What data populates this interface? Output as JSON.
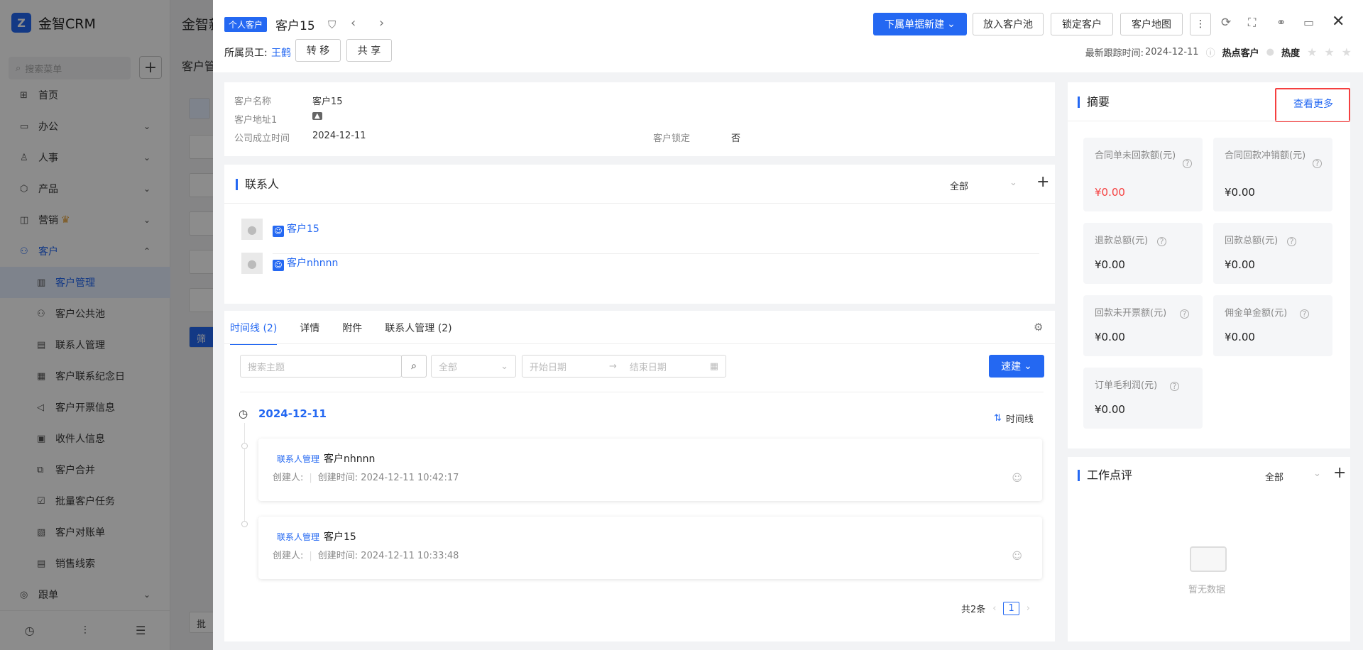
{
  "app": {
    "name": "金智CRM"
  },
  "sidebar": {
    "search_placeholder": "搜索菜单",
    "items": [
      {
        "label": "首页",
        "icon": "home-icon"
      },
      {
        "label": "办公",
        "icon": "office-icon"
      },
      {
        "label": "人事",
        "icon": "people-icon"
      },
      {
        "label": "产品",
        "icon": "product-icon"
      },
      {
        "label": "营销",
        "icon": "marketing-icon"
      },
      {
        "label": "客户",
        "icon": "customer-icon"
      },
      {
        "label": "跟单",
        "icon": "follow-icon"
      }
    ],
    "sub_items": [
      "客户管理",
      "客户公共池",
      "联系人管理",
      "客户联系纪念日",
      "客户开票信息",
      "收件人信息",
      "客户合并",
      "批量客户任务",
      "客户对账单",
      "销售线索"
    ]
  },
  "background": {
    "title": "金智新",
    "crumb": "客户管",
    "filter_btn": "筛",
    "bottom_btn": "批"
  },
  "drawer": {
    "tag": "个人客户",
    "title": "客户15",
    "employee_label": "所属员工:",
    "employee_name": "王鹤",
    "transfer_btn": "转 移",
    "share_btn": "共 享",
    "actions": {
      "new_btn": "下属单据新建",
      "pool_btn": "放入客户池",
      "lock_btn": "锁定客户",
      "map_btn": "客户地图"
    },
    "last_follow_label": "最新跟踪时间:",
    "last_follow_value": "2024-12-11",
    "hot_label": "热点客户",
    "heat_label": "热度",
    "heat_rating": 0,
    "info": {
      "name_label": "客户名称",
      "name_value": "客户15",
      "address_label": "客户地址1",
      "founded_label": "公司成立时间",
      "founded_value": "2024-12-11",
      "lock_label": "客户锁定",
      "lock_value": "否"
    },
    "contacts": {
      "title": "联系人",
      "filter": "全部",
      "items": [
        "客户15",
        "客户nhnnn"
      ]
    },
    "timeline": {
      "tabs": [
        "时间线 (2)",
        "详情",
        "附件",
        "联系人管理 (2)"
      ],
      "search_placeholder": "搜索主题",
      "type_filter": "全部",
      "start_placeholder": "开始日期",
      "end_placeholder": "结束日期",
      "quick_btn": "速建",
      "date": "2024-12-11",
      "view_label": "时间线",
      "entries": [
        {
          "type": "联系人管理",
          "name": "客户nhnnn",
          "creator_label": "创建人:",
          "created": "创建时间: 2024-12-11 10:42:17"
        },
        {
          "type": "联系人管理",
          "name": "客户15",
          "creator_label": "创建人:",
          "created": "创建时间: 2024-12-11 10:33:48"
        }
      ],
      "total": "共2条",
      "page": "1"
    },
    "summary": {
      "title": "摘要",
      "more": "查看更多",
      "items": [
        {
          "label": "合同单未回款额(元)",
          "value": "¥0.00",
          "color": "#f53f3f"
        },
        {
          "label": "合同回款冲销额(元)",
          "value": "¥0.00"
        },
        {
          "label": "退款总额(元)",
          "value": "¥0.00"
        },
        {
          "label": "回款总额(元)",
          "value": "¥0.00"
        },
        {
          "label": "回款未开票额(元)",
          "value": "¥0.00"
        },
        {
          "label": "佣金单金额(元)",
          "value": "¥0.00"
        },
        {
          "label": "订单毛利润(元)",
          "value": "¥0.00"
        }
      ]
    },
    "review": {
      "title": "工作点评",
      "filter": "全部",
      "empty": "暂无数据"
    }
  }
}
